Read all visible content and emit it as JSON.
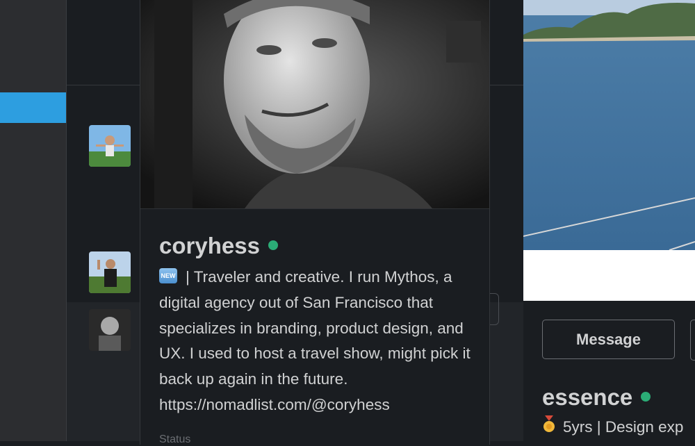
{
  "profile": {
    "username": "coryhess",
    "badge": "NEW",
    "bio": "| Traveler and creative. I run Mythos, a digital agency out of San Francisco that specializes in branding, product design, and UX. I used to host a travel show, might pick it back up again in the future. https://nomadlist.com/@coryhess",
    "presence_color": "#2bac76",
    "status_peek": "Status"
  },
  "secondary_profile": {
    "message_button": "Message",
    "username": "essence",
    "bio": "5yrs | Design exp",
    "medal_icon": "medal-icon"
  },
  "colors": {
    "sidebar": "#2c2d30",
    "sidebar_active": "#2d9ee0",
    "background": "#1a1d21",
    "text": "#d1d2d3",
    "online": "#2bac76"
  }
}
